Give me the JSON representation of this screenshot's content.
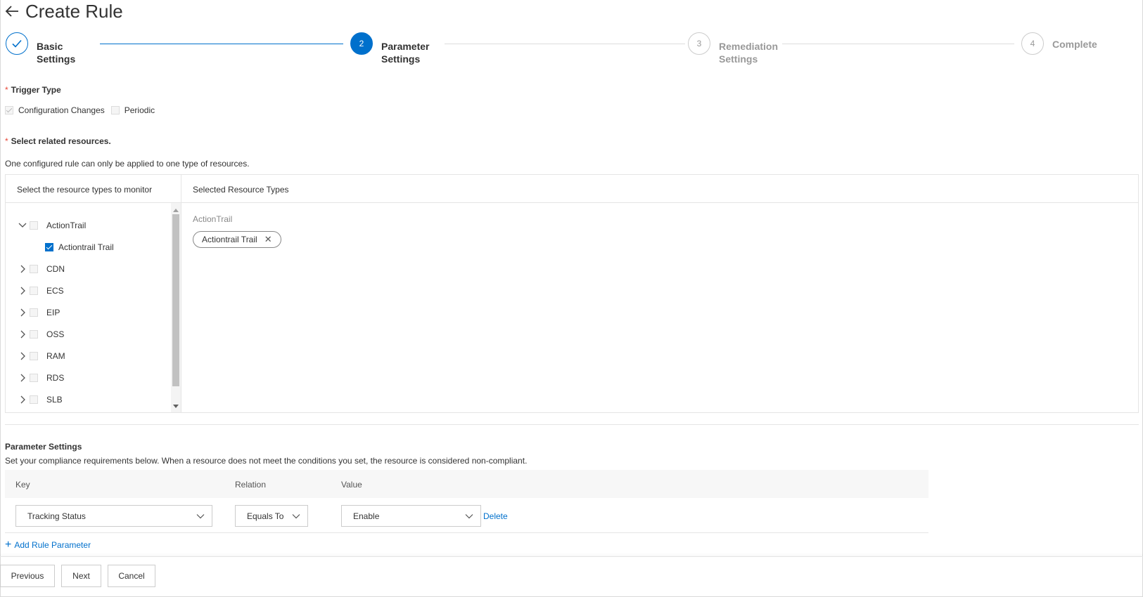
{
  "header": {
    "title": "Create Rule"
  },
  "steps": [
    {
      "label_line1": "Basic",
      "label_line2": "Settings",
      "number": ""
    },
    {
      "label_line1": "Parameter",
      "label_line2": "Settings",
      "number": "2"
    },
    {
      "label_line1": "Remediation",
      "label_line2": "Settings",
      "number": "3"
    },
    {
      "label_line1": "Complete",
      "label_line2": "",
      "number": "4"
    }
  ],
  "trigger": {
    "label": "Trigger Type",
    "options": [
      "Configuration Changes",
      "Periodic"
    ]
  },
  "resources": {
    "label": "Select related resources.",
    "hint": "One configured rule can only be applied to one type of resources.",
    "left_header": "Select the resource types to monitor",
    "right_header": "Selected Resource Types",
    "tree": [
      "ActionTrail",
      "Actiontrail Trail",
      "CDN",
      "ECS",
      "EIP",
      "OSS",
      "RAM",
      "RDS",
      "SLB"
    ],
    "selected_group": "ActionTrail",
    "selected_tag": "Actiontrail Trail",
    "tag_close": "✕"
  },
  "params": {
    "title": "Parameter Settings",
    "description": "Set your compliance requirements below. When a resource does not meet the conditions you set, the resource is considered non-compliant.",
    "columns": [
      "Key",
      "Relation",
      "Value"
    ],
    "row": {
      "key": "Tracking Status",
      "relation": "Equals To",
      "value": "Enable",
      "delete": "Delete"
    },
    "add_label": "Add Rule Parameter",
    "add_icon": "+"
  },
  "footer": {
    "previous": "Previous",
    "next": "Next",
    "cancel": "Cancel"
  },
  "colors": {
    "accent": "#0070cc",
    "required": "#e84738"
  }
}
